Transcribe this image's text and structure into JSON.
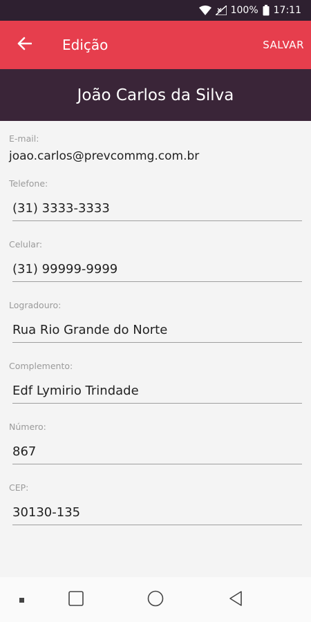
{
  "status_bar": {
    "battery": "100%",
    "time": "17:11"
  },
  "toolbar": {
    "title": "Edição",
    "save_label": "SALVAR"
  },
  "header": {
    "name": "João Carlos da Silva"
  },
  "email": {
    "label": "E-mail:",
    "value": "joao.carlos@prevcommg.com.br"
  },
  "fields": [
    {
      "label": "Telefone:",
      "value": "(31) 3333-3333"
    },
    {
      "label": "Celular:",
      "value": "(31) 99999-9999"
    },
    {
      "label": "Logradouro:",
      "value": "Rua Rio Grande do Norte"
    },
    {
      "label": "Complemento:",
      "value": "Edf Lymirio Trindade"
    },
    {
      "label": "Número:",
      "value": "867"
    },
    {
      "label": "CEP:",
      "value": "30130-135"
    }
  ],
  "colors": {
    "toolbar": "#e63e4d",
    "header": "#3a2538",
    "status_bar": "#2e2030"
  }
}
